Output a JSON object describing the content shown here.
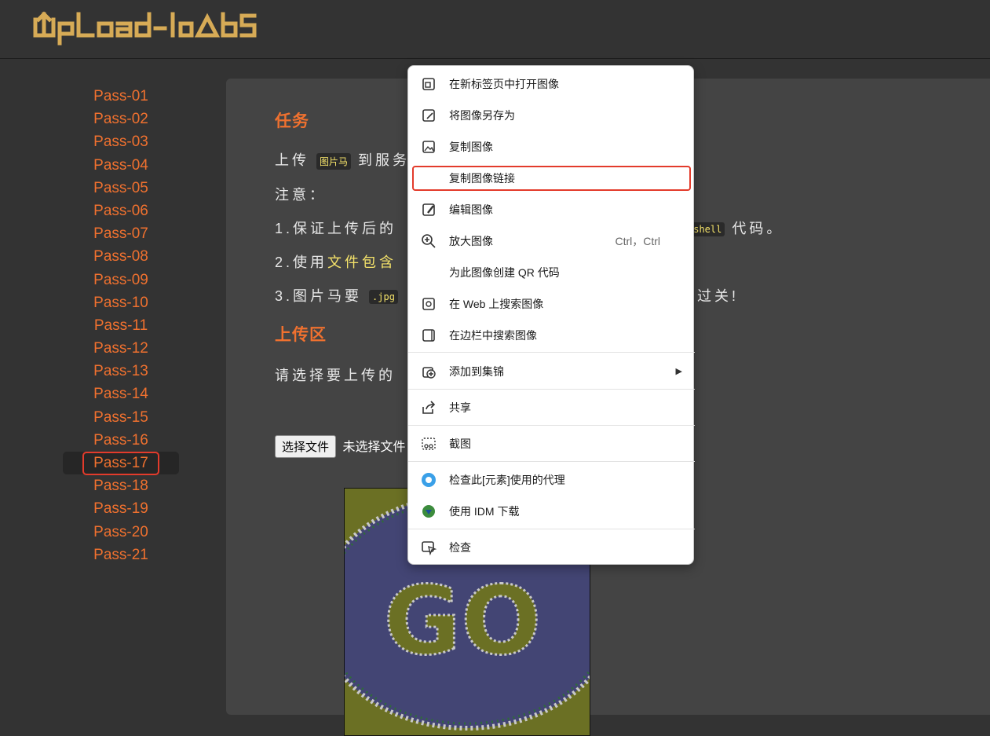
{
  "app": {
    "logo_text": "UpLoad-labS"
  },
  "sidebar": {
    "items": [
      {
        "label": "Pass-01"
      },
      {
        "label": "Pass-02"
      },
      {
        "label": "Pass-03"
      },
      {
        "label": "Pass-04"
      },
      {
        "label": "Pass-05"
      },
      {
        "label": "Pass-06"
      },
      {
        "label": "Pass-07"
      },
      {
        "label": "Pass-08"
      },
      {
        "label": "Pass-09"
      },
      {
        "label": "Pass-10"
      },
      {
        "label": "Pass-11"
      },
      {
        "label": "Pass-12"
      },
      {
        "label": "Pass-13"
      },
      {
        "label": "Pass-14"
      },
      {
        "label": "Pass-15"
      },
      {
        "label": "Pass-16"
      },
      {
        "label": "Pass-17"
      },
      {
        "label": "Pass-18"
      },
      {
        "label": "Pass-19"
      },
      {
        "label": "Pass-20"
      },
      {
        "label": "Pass-21"
      }
    ],
    "active": "Pass-17"
  },
  "task": {
    "heading": "任务",
    "line1_prefix": "上传",
    "line1_code": "图片马",
    "line1_suffix": "到服务",
    "note": "注意：",
    "item1_prefix": "1.保证上传后的",
    "item1_code": "oshell",
    "item1_suffix": "代码。",
    "item2_prefix": "2.使用",
    "item2_highlight": "文件包含",
    "item3_prefix": "3.图片马要",
    "item3_code": ".jpg",
    "item3_suffix": "过关!"
  },
  "upload": {
    "heading": "上传区",
    "prompt": "请选择要上传的",
    "choose_button": "选择文件",
    "no_file_text": "未选择文件",
    "preview_text": "GO"
  },
  "context_menu": {
    "items": [
      {
        "label": "在新标签页中打开图像",
        "icon": "open-new-tab-icon"
      },
      {
        "label": "将图像另存为",
        "icon": "save-image-icon"
      },
      {
        "label": "复制图像",
        "icon": "copy-image-icon"
      },
      {
        "label": "复制图像链接",
        "icon": ""
      },
      {
        "label": "编辑图像",
        "icon": "edit-image-icon"
      },
      {
        "label": "放大图像",
        "icon": "zoom-in-icon",
        "shortcut": "Ctrl，Ctrl"
      },
      {
        "label": "为此图像创建 QR 代码",
        "icon": ""
      },
      {
        "label": "在 Web 上搜索图像",
        "icon": "web-search-image-icon"
      },
      {
        "label": "在边栏中搜索图像",
        "icon": "sidebar-search-icon"
      },
      {
        "label": "添加到集锦",
        "icon": "collections-icon"
      },
      {
        "label": "共享",
        "icon": "share-icon"
      },
      {
        "label": "截图",
        "icon": "screenshot-icon"
      },
      {
        "label": "检查此[元素]使用的代理",
        "icon": "proxy-check-icon"
      },
      {
        "label": "使用 IDM 下载",
        "icon": "idm-icon"
      },
      {
        "label": "检查",
        "icon": "inspect-icon"
      }
    ],
    "highlighted": "复制图像链接"
  }
}
